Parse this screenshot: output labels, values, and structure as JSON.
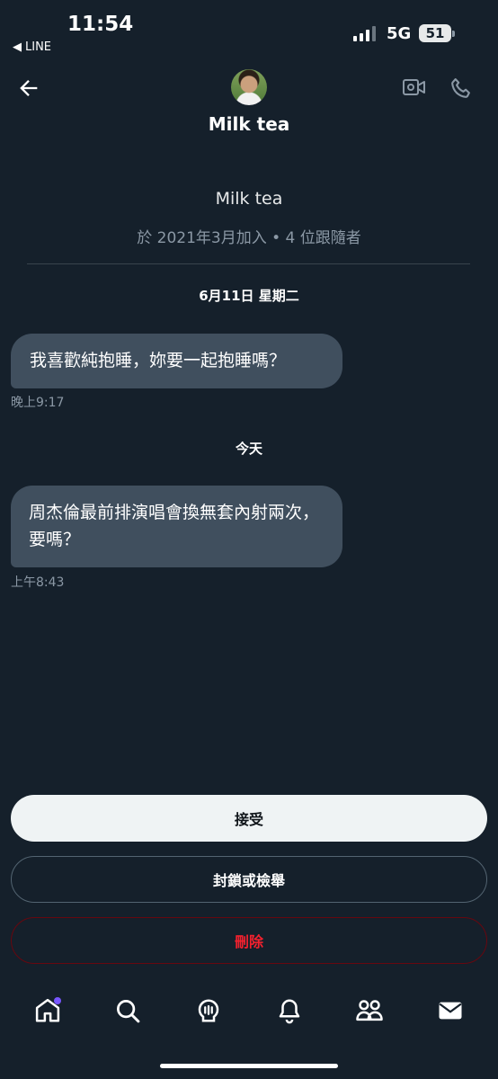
{
  "status_bar": {
    "time": "11:54",
    "back_app": "LINE",
    "network": "5G",
    "battery": "51"
  },
  "header": {
    "title": "Milk tea"
  },
  "profile": {
    "name": "Milk tea",
    "meta": "於 2021年3月加入 • 4 位跟隨者"
  },
  "messages": [
    {
      "date": "6月11日 星期二",
      "text": "我喜歡純抱睡，妳要一起抱睡嗎？",
      "time": "晚上9:17"
    },
    {
      "date": "今天",
      "text": "周杰倫最前排演唱會換無套內射兩次，要嗎？",
      "time": "上午8:43"
    }
  ],
  "actions": {
    "accept": "接受",
    "block": "封鎖或檢舉",
    "delete": "刪除"
  },
  "colors": {
    "background": "#15202b",
    "bubble": "#404f5e",
    "danger": "#f4212e",
    "notification_dot": "#7856ff"
  },
  "nav": [
    "home-icon",
    "search-icon",
    "spaces-icon",
    "bell-icon",
    "communities-icon",
    "mail-icon"
  ]
}
